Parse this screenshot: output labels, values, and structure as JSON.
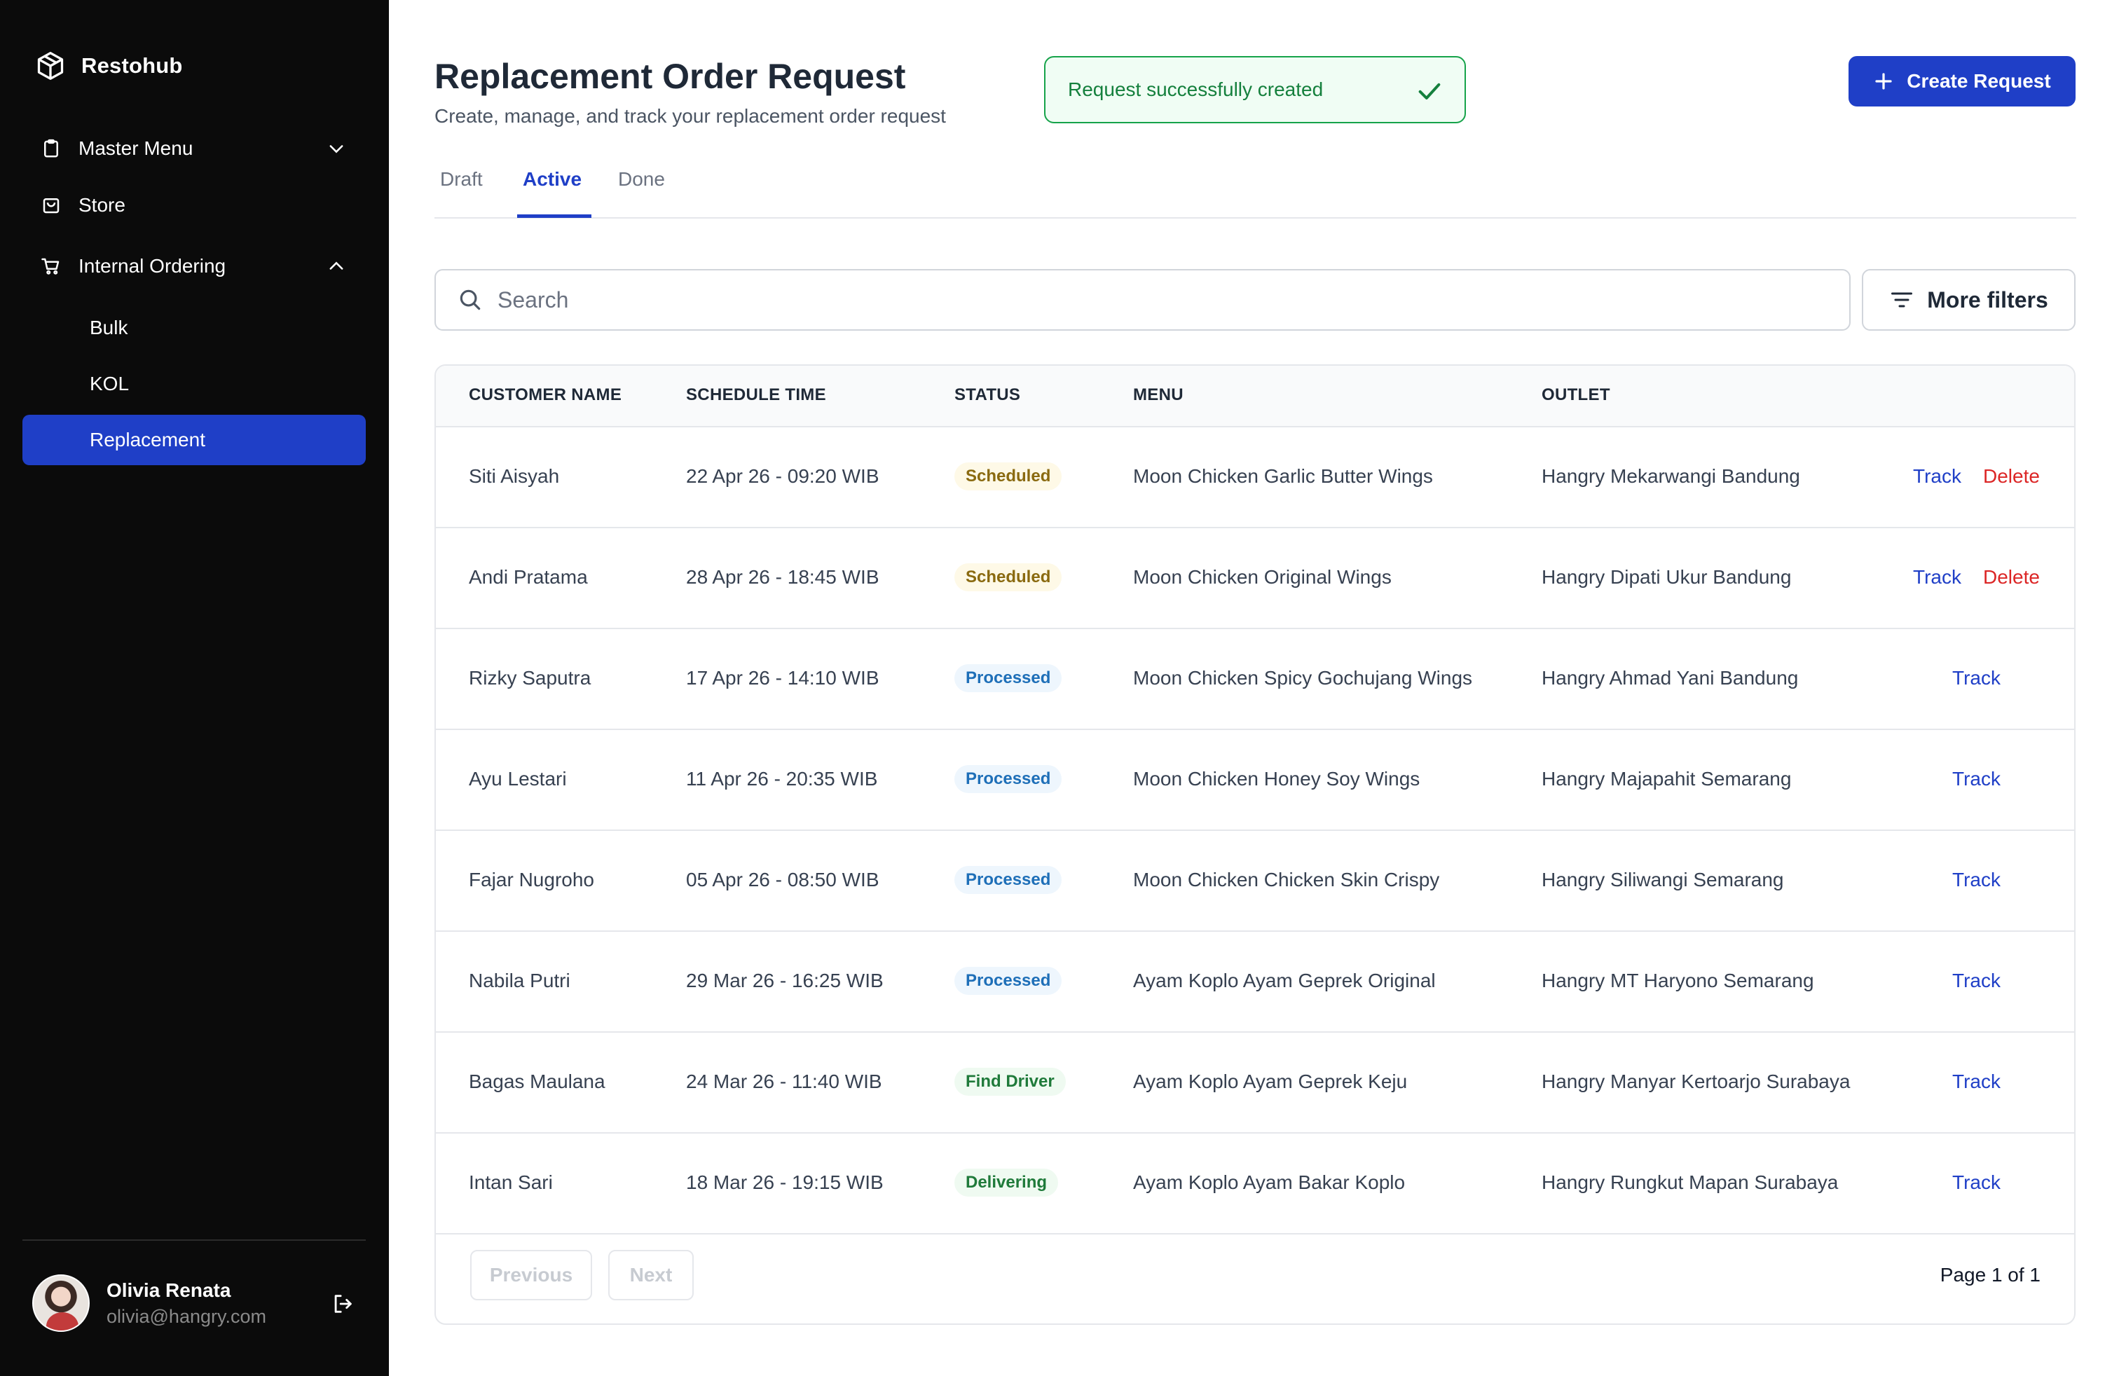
{
  "app": {
    "name": "Restohub"
  },
  "sidebar": {
    "items": [
      {
        "label": "Master Menu"
      },
      {
        "label": "Store"
      },
      {
        "label": "Internal Ordering"
      },
      {
        "label": "Bulk"
      },
      {
        "label": "KOL"
      },
      {
        "label": "Replacement"
      }
    ]
  },
  "user": {
    "name": "Olivia Renata",
    "email": "olivia@hangry.com"
  },
  "header": {
    "title": "Replacement Order Request",
    "subtitle": "Create, manage, and track your replacement order request",
    "toast": "Request successfully created",
    "create_label": "Create Request"
  },
  "tabs": [
    {
      "label": "Draft"
    },
    {
      "label": "Active"
    },
    {
      "label": "Done"
    }
  ],
  "search": {
    "placeholder": "Search"
  },
  "filters": {
    "label": "More filters"
  },
  "table": {
    "columns": [
      "CUSTOMER NAME",
      "SCHEDULE TIME",
      "STATUS",
      "MENU",
      "OUTLET"
    ],
    "rows": [
      {
        "customer": "Siti Aisyah",
        "schedule": "22 Apr 26 - 09:20 WIB",
        "status": "Scheduled",
        "menu": "Moon Chicken Garlic Butter Wings",
        "outlet": "Hangry Mekarwangi Bandung",
        "track": "Track",
        "delete": "Delete"
      },
      {
        "customer": "Andi Pratama",
        "schedule": "28 Apr 26 - 18:45 WIB",
        "status": "Scheduled",
        "menu": "Moon Chicken Original Wings",
        "outlet": "Hangry Dipati Ukur Bandung",
        "track": "Track",
        "delete": "Delete"
      },
      {
        "customer": "Rizky Saputra",
        "schedule": "17 Apr 26 - 14:10 WIB",
        "status": "Processed",
        "menu": "Moon Chicken Spicy Gochujang Wings",
        "outlet": "Hangry Ahmad Yani Bandung",
        "track": "Track"
      },
      {
        "customer": "Ayu Lestari",
        "schedule": "11 Apr 26 - 20:35 WIB",
        "status": "Processed",
        "menu": "Moon Chicken Honey Soy Wings",
        "outlet": "Hangry Majapahit Semarang",
        "track": "Track"
      },
      {
        "customer": "Fajar Nugroho",
        "schedule": "05 Apr 26 - 08:50 WIB",
        "status": "Processed",
        "menu": "Moon Chicken Chicken Skin Crispy",
        "outlet": "Hangry Siliwangi Semarang",
        "track": "Track"
      },
      {
        "customer": "Nabila Putri",
        "schedule": "29 Mar 26 - 16:25 WIB",
        "status": "Processed",
        "menu": "Ayam Koplo Ayam Geprek Original",
        "outlet": "Hangry MT Haryono Semarang",
        "track": "Track"
      },
      {
        "customer": "Bagas Maulana",
        "schedule": "24 Mar 26 - 11:40 WIB",
        "status": "Find Driver",
        "menu": "Ayam Koplo Ayam Geprek Keju",
        "outlet": "Hangry Manyar Kertoarjo Surabaya",
        "track": "Track"
      },
      {
        "customer": "Intan Sari",
        "schedule": "18 Mar 26 - 19:15 WIB",
        "status": "Delivering",
        "menu": "Ayam Koplo Ayam Bakar Koplo",
        "outlet": "Hangry Rungkut Mapan Surabaya",
        "track": "Track"
      }
    ]
  },
  "pagination": {
    "previous": "Previous",
    "next": "Next",
    "page_info": "Page 1 of 1"
  },
  "colors": {
    "accent": "#1f3fc7",
    "success": "#16a34a",
    "danger": "#dc2626",
    "sidebar_bg": "#0b0b0b"
  }
}
